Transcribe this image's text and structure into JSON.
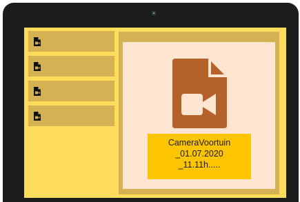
{
  "sidebar": {
    "items": [
      {
        "icon": "video-file-icon"
      },
      {
        "icon": "video-file-icon"
      },
      {
        "icon": "video-file-icon"
      },
      {
        "icon": "video-file-icon"
      }
    ]
  },
  "main": {
    "file": {
      "icon": "video-file-icon",
      "name_lines": [
        "CameraVoortuin",
        "_01.07.2020",
        "_11.11h....."
      ]
    }
  },
  "colors": {
    "screen_bg": "#fcdc5a",
    "panel_bg": "#d4b254",
    "preview_bg": "#fde5d2",
    "label_bg": "#fdc400",
    "file_icon": "#b5622a"
  }
}
